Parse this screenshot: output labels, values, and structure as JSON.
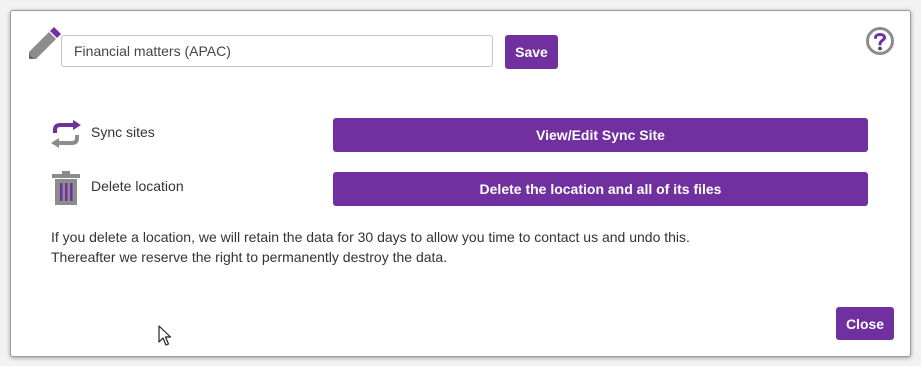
{
  "dialog": {
    "location_name_value": "Financial matters (APAC)",
    "save_label": "Save",
    "help_icon": "question-circle-icon",
    "edit_icon": "pencil-icon"
  },
  "sync": {
    "icon": "sync-icon",
    "label": "Sync sites",
    "button_label": "View/Edit Sync Site"
  },
  "delete": {
    "icon": "trash-icon",
    "label": "Delete location",
    "button_label": "Delete the location and all of its files"
  },
  "info": {
    "line1": "If you delete a location, we will retain the data for 30 days to allow you time to contact us and undo this.",
    "line2": "Thereafter we reserve the right to permanently destroy the data."
  },
  "footer": {
    "close_label": "Close"
  },
  "colors": {
    "accent": "#7030a0",
    "icon_gray": "#8c8c8c"
  }
}
